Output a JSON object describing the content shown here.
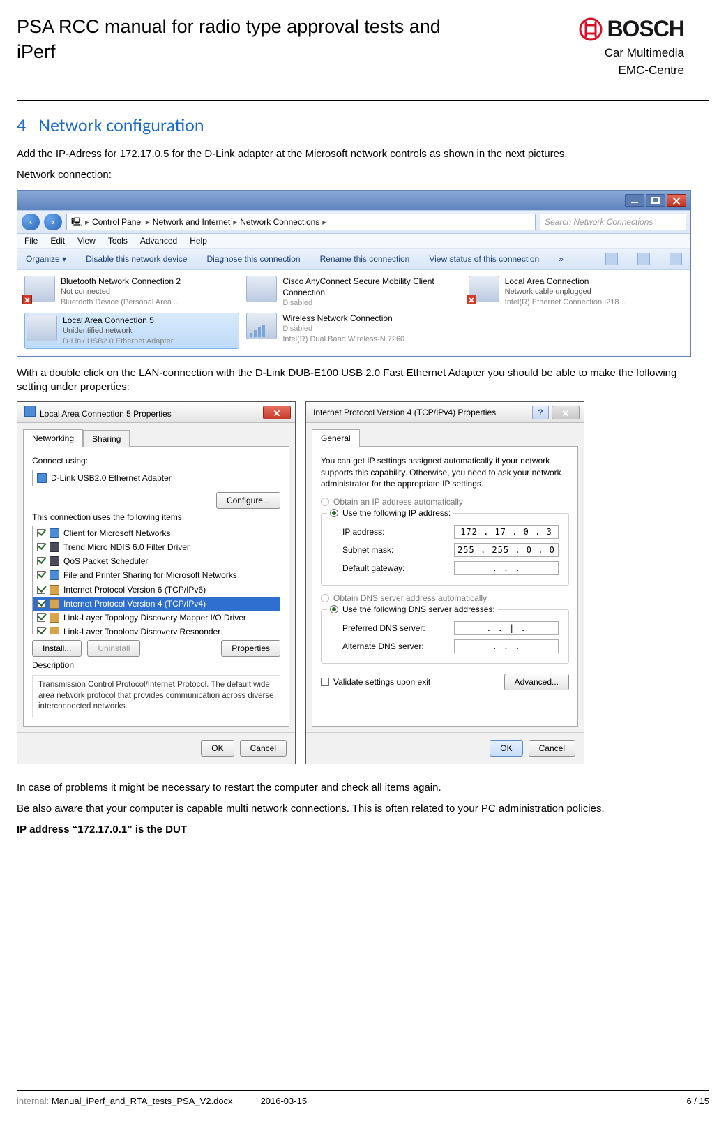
{
  "header": {
    "title": "PSA RCC manual for radio type approval tests and iPerf",
    "brand_word": "BOSCH",
    "brand_line1": "Car Multimedia",
    "brand_line2": "EMC-Centre"
  },
  "section": {
    "number": "4",
    "title": "Network configuration"
  },
  "body": {
    "p1": "Add the IP-Adress for 172.17.0.5 for the D-Link adapter at the Microsoft network controls as shown in the next pictures.",
    "p2": "Network connection:",
    "p3": "With a double click on the LAN-connection with the D-Link DUB-E100 USB 2.0 Fast Ethernet Adapter you should be able to make the following setting under properties:",
    "p4": "In case of problems it might be necessary to restart the computer and check all items again.",
    "p5": "Be also aware that your computer is capable multi network connections. This is often related to your PC administration policies.",
    "p6": "IP address “172.17.0.1” is the DUT"
  },
  "netwin": {
    "breadcrumb": [
      "Control Panel",
      "Network and Internet",
      "Network Connections"
    ],
    "search_placeholder": "Search Network Connections",
    "menu": [
      "File",
      "Edit",
      "View",
      "Tools",
      "Advanced",
      "Help"
    ],
    "toolbar": [
      "Organize ▾",
      "Disable this network device",
      "Diagnose this connection",
      "Rename this connection",
      "View status of this connection",
      "»"
    ],
    "items": [
      {
        "name": "Bluetooth Network Connection 2",
        "l2": "Not connected",
        "l3": "Bluetooth Device (Personal Area ...",
        "x": true,
        "selected": false
      },
      {
        "name": "Cisco AnyConnect Secure Mobility Client Connection",
        "l2": "Disabled",
        "l3": "",
        "x": false,
        "selected": false,
        "grey": true
      },
      {
        "name": "Local Area Connection",
        "l2": "Network cable unplugged",
        "l3": "Intel(R) Ethernet Connection I218...",
        "x": true,
        "selected": false
      },
      {
        "name": "Local Area Connection 5",
        "l2": "Unidentified network",
        "l3": "D-Link USB2.0 Ethernet Adapter",
        "x": false,
        "selected": true
      },
      {
        "name": "Wireless Network Connection",
        "l2": "Disabled",
        "l3": "Intel(R) Dual Band Wireless-N 7260",
        "x": false,
        "selected": false,
        "grey": true,
        "bars": true
      }
    ]
  },
  "lanprops": {
    "title": "Local Area Connection 5 Properties",
    "tabs": [
      "Networking",
      "Sharing"
    ],
    "connect_label": "Connect using:",
    "adapter": "D-Link USB2.0 Ethernet Adapter",
    "configure": "Configure...",
    "uses_label": "This connection uses the following items:",
    "items": [
      {
        "label": "Client for Microsoft Networks",
        "icon": "blue"
      },
      {
        "label": "Trend Micro NDIS 6.0 Filter Driver",
        "icon": "dark"
      },
      {
        "label": "QoS Packet Scheduler",
        "icon": "dark"
      },
      {
        "label": "File and Printer Sharing for Microsoft Networks",
        "icon": "blue"
      },
      {
        "label": "Internet Protocol Version 6 (TCP/IPv6)",
        "icon": "gold"
      },
      {
        "label": "Internet Protocol Version 4 (TCP/IPv4)",
        "icon": "gold",
        "selected": true
      },
      {
        "label": "Link-Layer Topology Discovery Mapper I/O Driver",
        "icon": "gold"
      },
      {
        "label": "Link-Layer Topology Discovery Responder",
        "icon": "gold"
      }
    ],
    "install": "Install...",
    "uninstall": "Uninstall",
    "properties": "Properties",
    "desc_label": "Description",
    "desc_text": "Transmission Control Protocol/Internet Protocol. The default wide area network protocol that provides communication across diverse interconnected networks.",
    "ok": "OK",
    "cancel": "Cancel"
  },
  "ipv4": {
    "title": "Internet Protocol Version 4 (TCP/IPv4) Properties",
    "tab": "General",
    "intro": "You can get IP settings assigned automatically if your network supports this capability. Otherwise, you need to ask your network administrator for the appropriate IP settings.",
    "opt_auto_ip": "Obtain an IP address automatically",
    "opt_use_ip": "Use the following IP address:",
    "ip_label": "IP address:",
    "ip_value": "172 . 17 . 0  . 3",
    "mask_label": "Subnet mask:",
    "mask_value": "255 . 255 . 0  . 0",
    "gw_label": "Default gateway:",
    "gw_value": ".    .    .",
    "opt_auto_dns": "Obtain DNS server address automatically",
    "opt_use_dns": "Use the following DNS server addresses:",
    "pref_dns_label": "Preferred DNS server:",
    "pref_dns_value": ".    .  | .",
    "alt_dns_label": "Alternate DNS server:",
    "alt_dns_value": ".    .    .",
    "validate": "Validate settings upon exit",
    "advanced": "Advanced...",
    "ok": "OK",
    "cancel": "Cancel"
  },
  "footer": {
    "classified": "internal:",
    "file": "Manual_iPerf_and_RTA_tests_PSA_V2.docx",
    "date": "2016-03-15",
    "page": "6 / 15"
  }
}
